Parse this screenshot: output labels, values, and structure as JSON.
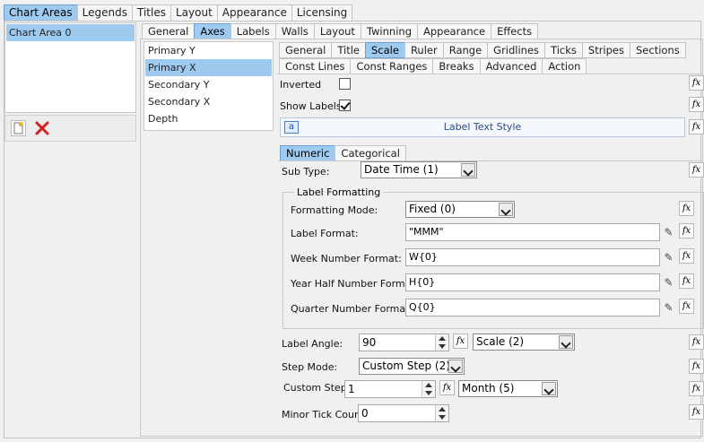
{
  "top_tabs": [
    "Chart Areas",
    "Legends",
    "Titles",
    "Layout",
    "Appearance",
    "Licensing"
  ],
  "chart_areas": {
    "items": [
      "Chart Area 0"
    ]
  },
  "area_tabs": [
    "General",
    "Axes",
    "Labels",
    "Walls",
    "Layout",
    "Twinning",
    "Appearance",
    "Effects"
  ],
  "axes_list": [
    "Primary Y",
    "Primary X",
    "Secondary Y",
    "Secondary X",
    "Depth"
  ],
  "axis_tabs_row1": [
    "General",
    "Title",
    "Scale",
    "Ruler",
    "Range",
    "Gridlines",
    "Ticks",
    "Stripes",
    "Sections"
  ],
  "axis_tabs_row2": [
    "Const Lines",
    "Const Ranges",
    "Breaks",
    "Advanced",
    "Action"
  ],
  "scale": {
    "inverted_label": "Inverted",
    "inverted_checked": false,
    "show_labels_label": "Show Labels",
    "show_labels_checked": true,
    "label_text_style": "Label Text Style",
    "scale_tabs": [
      "Numeric",
      "Categorical"
    ],
    "sub_type_label": "Sub Type:",
    "sub_type_value": "Date Time (1)",
    "label_formatting": {
      "title": "Label Formatting",
      "formatting_mode_label": "Formatting Mode:",
      "formatting_mode_value": "Fixed (0)",
      "label_format_label": "Label Format:",
      "label_format_value": "\"MMM\"",
      "week_number_label": "Week Number Format:",
      "week_number_value": "W{0}",
      "year_half_label": "Year Half Number Format:",
      "year_half_value": "H{0}",
      "quarter_number_label": "Quarter Number Format:",
      "quarter_number_value": "Q{0}"
    },
    "label_angle_label": "Label Angle:",
    "label_angle_value": "90",
    "label_angle_mode": "Scale (2)",
    "step_mode_label": "Step Mode:",
    "step_mode_value": "Custom Step (2)",
    "custom_step_label": "Custom Step:",
    "custom_step_value": "1",
    "custom_step_unit": "Month (5)",
    "minor_tick_label": "Minor Tick Count:",
    "minor_tick_value": "0"
  },
  "icons": {
    "fx": "fx-icon",
    "pen": "pencil-icon",
    "new": "new-document-icon",
    "delete": "delete-icon",
    "text_style": "text-style-icon"
  },
  "colors": {
    "selected_tab": "#9fcaf0",
    "delete_red": "#d42020"
  }
}
